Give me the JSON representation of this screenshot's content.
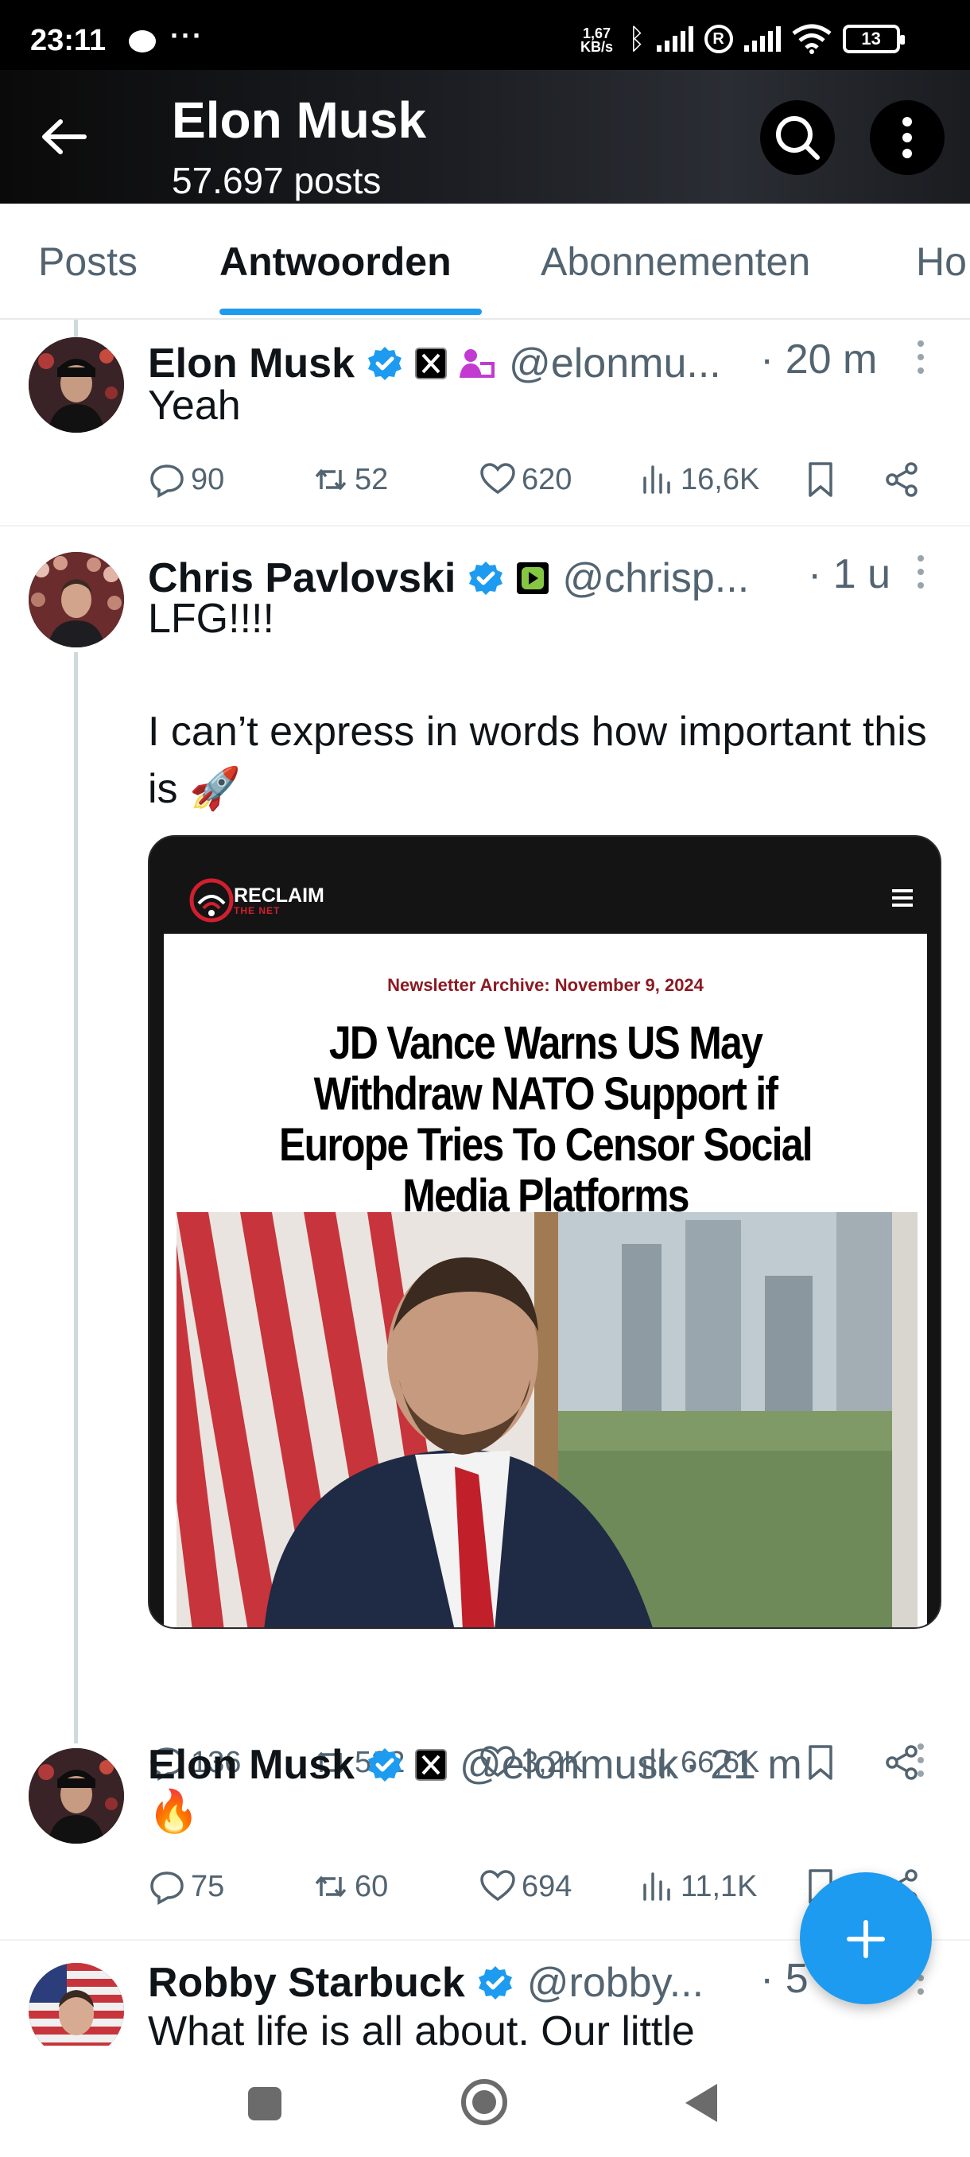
{
  "status_bar": {
    "time": "23:11",
    "speed_value": "1,67",
    "speed_unit": "KB/s",
    "battery": "13",
    "icons": [
      "chat-bubble-icon",
      "more-dots-icon",
      "bluetooth-icon",
      "signal-icon",
      "roaming-icon",
      "signal-icon",
      "wifi-icon",
      "battery-icon"
    ]
  },
  "header": {
    "title": "Elon Musk",
    "subtitle": "57.697 posts"
  },
  "tabs": [
    {
      "label": "Posts"
    },
    {
      "label": "Antwoorden",
      "active": true
    },
    {
      "label": "Abonnementen"
    },
    {
      "label": "Ho"
    }
  ],
  "posts": [
    {
      "name": "Elon Musk",
      "handle": "@elonmu...",
      "time": "· 20 m",
      "text": "Yeah",
      "replies": "90",
      "reposts": "52",
      "likes": "620",
      "views": "16,6K"
    },
    {
      "name": "Chris Pavlovski",
      "handle": "@chrisp...",
      "time": "· 1 u",
      "text_line1": "LFG!!!!",
      "text_line2": "I can’t express in words how important this is 🚀",
      "media": {
        "site_name": "RECLAIM",
        "site_sub": "THE NET",
        "label": "Newsletter Archive: November 9, 2024",
        "headline": "JD Vance Warns US May Withdraw NATO Support if Europe Tries To Censor Social Media Platforms"
      },
      "replies": "136",
      "reposts": "532",
      "likes": "3,2K",
      "views": "66,6K"
    },
    {
      "name": "Elon Musk",
      "handle": "@elonmusk",
      "time": "· 21 m",
      "text": "🔥",
      "replies": "75",
      "reposts": "60",
      "likes": "694",
      "views": "11,1K"
    },
    {
      "name": "Robby Starbuck",
      "handle": "@robby...",
      "time": "· 5",
      "text": "What life is all about. Our little"
    }
  ],
  "colors": {
    "accent": "#1d9bf0",
    "text": "#0f1419",
    "muted": "#536471"
  }
}
